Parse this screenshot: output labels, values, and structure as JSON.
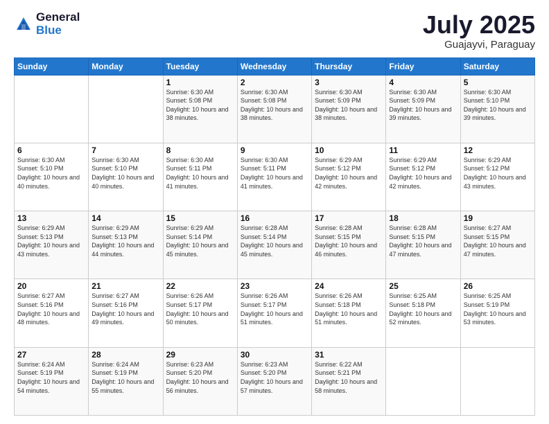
{
  "header": {
    "logo_general": "General",
    "logo_blue": "Blue",
    "month_title": "July 2025",
    "location": "Guajayvi, Paraguay"
  },
  "days_of_week": [
    "Sunday",
    "Monday",
    "Tuesday",
    "Wednesday",
    "Thursday",
    "Friday",
    "Saturday"
  ],
  "weeks": [
    [
      {
        "day": "",
        "sunrise": "",
        "sunset": "",
        "daylight": ""
      },
      {
        "day": "",
        "sunrise": "",
        "sunset": "",
        "daylight": ""
      },
      {
        "day": "1",
        "sunrise": "Sunrise: 6:30 AM",
        "sunset": "Sunset: 5:08 PM",
        "daylight": "Daylight: 10 hours and 38 minutes."
      },
      {
        "day": "2",
        "sunrise": "Sunrise: 6:30 AM",
        "sunset": "Sunset: 5:08 PM",
        "daylight": "Daylight: 10 hours and 38 minutes."
      },
      {
        "day": "3",
        "sunrise": "Sunrise: 6:30 AM",
        "sunset": "Sunset: 5:09 PM",
        "daylight": "Daylight: 10 hours and 38 minutes."
      },
      {
        "day": "4",
        "sunrise": "Sunrise: 6:30 AM",
        "sunset": "Sunset: 5:09 PM",
        "daylight": "Daylight: 10 hours and 39 minutes."
      },
      {
        "day": "5",
        "sunrise": "Sunrise: 6:30 AM",
        "sunset": "Sunset: 5:10 PM",
        "daylight": "Daylight: 10 hours and 39 minutes."
      }
    ],
    [
      {
        "day": "6",
        "sunrise": "Sunrise: 6:30 AM",
        "sunset": "Sunset: 5:10 PM",
        "daylight": "Daylight: 10 hours and 40 minutes."
      },
      {
        "day": "7",
        "sunrise": "Sunrise: 6:30 AM",
        "sunset": "Sunset: 5:10 PM",
        "daylight": "Daylight: 10 hours and 40 minutes."
      },
      {
        "day": "8",
        "sunrise": "Sunrise: 6:30 AM",
        "sunset": "Sunset: 5:11 PM",
        "daylight": "Daylight: 10 hours and 41 minutes."
      },
      {
        "day": "9",
        "sunrise": "Sunrise: 6:30 AM",
        "sunset": "Sunset: 5:11 PM",
        "daylight": "Daylight: 10 hours and 41 minutes."
      },
      {
        "day": "10",
        "sunrise": "Sunrise: 6:29 AM",
        "sunset": "Sunset: 5:12 PM",
        "daylight": "Daylight: 10 hours and 42 minutes."
      },
      {
        "day": "11",
        "sunrise": "Sunrise: 6:29 AM",
        "sunset": "Sunset: 5:12 PM",
        "daylight": "Daylight: 10 hours and 42 minutes."
      },
      {
        "day": "12",
        "sunrise": "Sunrise: 6:29 AM",
        "sunset": "Sunset: 5:12 PM",
        "daylight": "Daylight: 10 hours and 43 minutes."
      }
    ],
    [
      {
        "day": "13",
        "sunrise": "Sunrise: 6:29 AM",
        "sunset": "Sunset: 5:13 PM",
        "daylight": "Daylight: 10 hours and 43 minutes."
      },
      {
        "day": "14",
        "sunrise": "Sunrise: 6:29 AM",
        "sunset": "Sunset: 5:13 PM",
        "daylight": "Daylight: 10 hours and 44 minutes."
      },
      {
        "day": "15",
        "sunrise": "Sunrise: 6:29 AM",
        "sunset": "Sunset: 5:14 PM",
        "daylight": "Daylight: 10 hours and 45 minutes."
      },
      {
        "day": "16",
        "sunrise": "Sunrise: 6:28 AM",
        "sunset": "Sunset: 5:14 PM",
        "daylight": "Daylight: 10 hours and 45 minutes."
      },
      {
        "day": "17",
        "sunrise": "Sunrise: 6:28 AM",
        "sunset": "Sunset: 5:15 PM",
        "daylight": "Daylight: 10 hours and 46 minutes."
      },
      {
        "day": "18",
        "sunrise": "Sunrise: 6:28 AM",
        "sunset": "Sunset: 5:15 PM",
        "daylight": "Daylight: 10 hours and 47 minutes."
      },
      {
        "day": "19",
        "sunrise": "Sunrise: 6:27 AM",
        "sunset": "Sunset: 5:15 PM",
        "daylight": "Daylight: 10 hours and 47 minutes."
      }
    ],
    [
      {
        "day": "20",
        "sunrise": "Sunrise: 6:27 AM",
        "sunset": "Sunset: 5:16 PM",
        "daylight": "Daylight: 10 hours and 48 minutes."
      },
      {
        "day": "21",
        "sunrise": "Sunrise: 6:27 AM",
        "sunset": "Sunset: 5:16 PM",
        "daylight": "Daylight: 10 hours and 49 minutes."
      },
      {
        "day": "22",
        "sunrise": "Sunrise: 6:26 AM",
        "sunset": "Sunset: 5:17 PM",
        "daylight": "Daylight: 10 hours and 50 minutes."
      },
      {
        "day": "23",
        "sunrise": "Sunrise: 6:26 AM",
        "sunset": "Sunset: 5:17 PM",
        "daylight": "Daylight: 10 hours and 51 minutes."
      },
      {
        "day": "24",
        "sunrise": "Sunrise: 6:26 AM",
        "sunset": "Sunset: 5:18 PM",
        "daylight": "Daylight: 10 hours and 51 minutes."
      },
      {
        "day": "25",
        "sunrise": "Sunrise: 6:25 AM",
        "sunset": "Sunset: 5:18 PM",
        "daylight": "Daylight: 10 hours and 52 minutes."
      },
      {
        "day": "26",
        "sunrise": "Sunrise: 6:25 AM",
        "sunset": "Sunset: 5:19 PM",
        "daylight": "Daylight: 10 hours and 53 minutes."
      }
    ],
    [
      {
        "day": "27",
        "sunrise": "Sunrise: 6:24 AM",
        "sunset": "Sunset: 5:19 PM",
        "daylight": "Daylight: 10 hours and 54 minutes."
      },
      {
        "day": "28",
        "sunrise": "Sunrise: 6:24 AM",
        "sunset": "Sunset: 5:19 PM",
        "daylight": "Daylight: 10 hours and 55 minutes."
      },
      {
        "day": "29",
        "sunrise": "Sunrise: 6:23 AM",
        "sunset": "Sunset: 5:20 PM",
        "daylight": "Daylight: 10 hours and 56 minutes."
      },
      {
        "day": "30",
        "sunrise": "Sunrise: 6:23 AM",
        "sunset": "Sunset: 5:20 PM",
        "daylight": "Daylight: 10 hours and 57 minutes."
      },
      {
        "day": "31",
        "sunrise": "Sunrise: 6:22 AM",
        "sunset": "Sunset: 5:21 PM",
        "daylight": "Daylight: 10 hours and 58 minutes."
      },
      {
        "day": "",
        "sunrise": "",
        "sunset": "",
        "daylight": ""
      },
      {
        "day": "",
        "sunrise": "",
        "sunset": "",
        "daylight": ""
      }
    ]
  ]
}
